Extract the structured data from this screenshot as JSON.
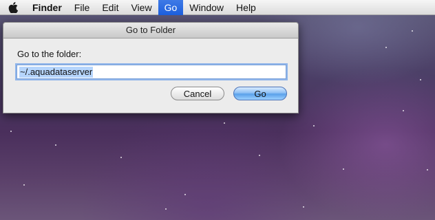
{
  "menubar": {
    "apple_icon": "apple-icon",
    "app_name": "Finder",
    "items": [
      "File",
      "Edit",
      "View",
      "Go",
      "Window",
      "Help"
    ],
    "active_item": "Go",
    "active_color": "#1c5fdd"
  },
  "dialog": {
    "title": "Go to Folder",
    "prompt": "Go to the folder:",
    "path_value": "~/.aquadataserver",
    "cancel_label": "Cancel",
    "go_label": "Go"
  }
}
